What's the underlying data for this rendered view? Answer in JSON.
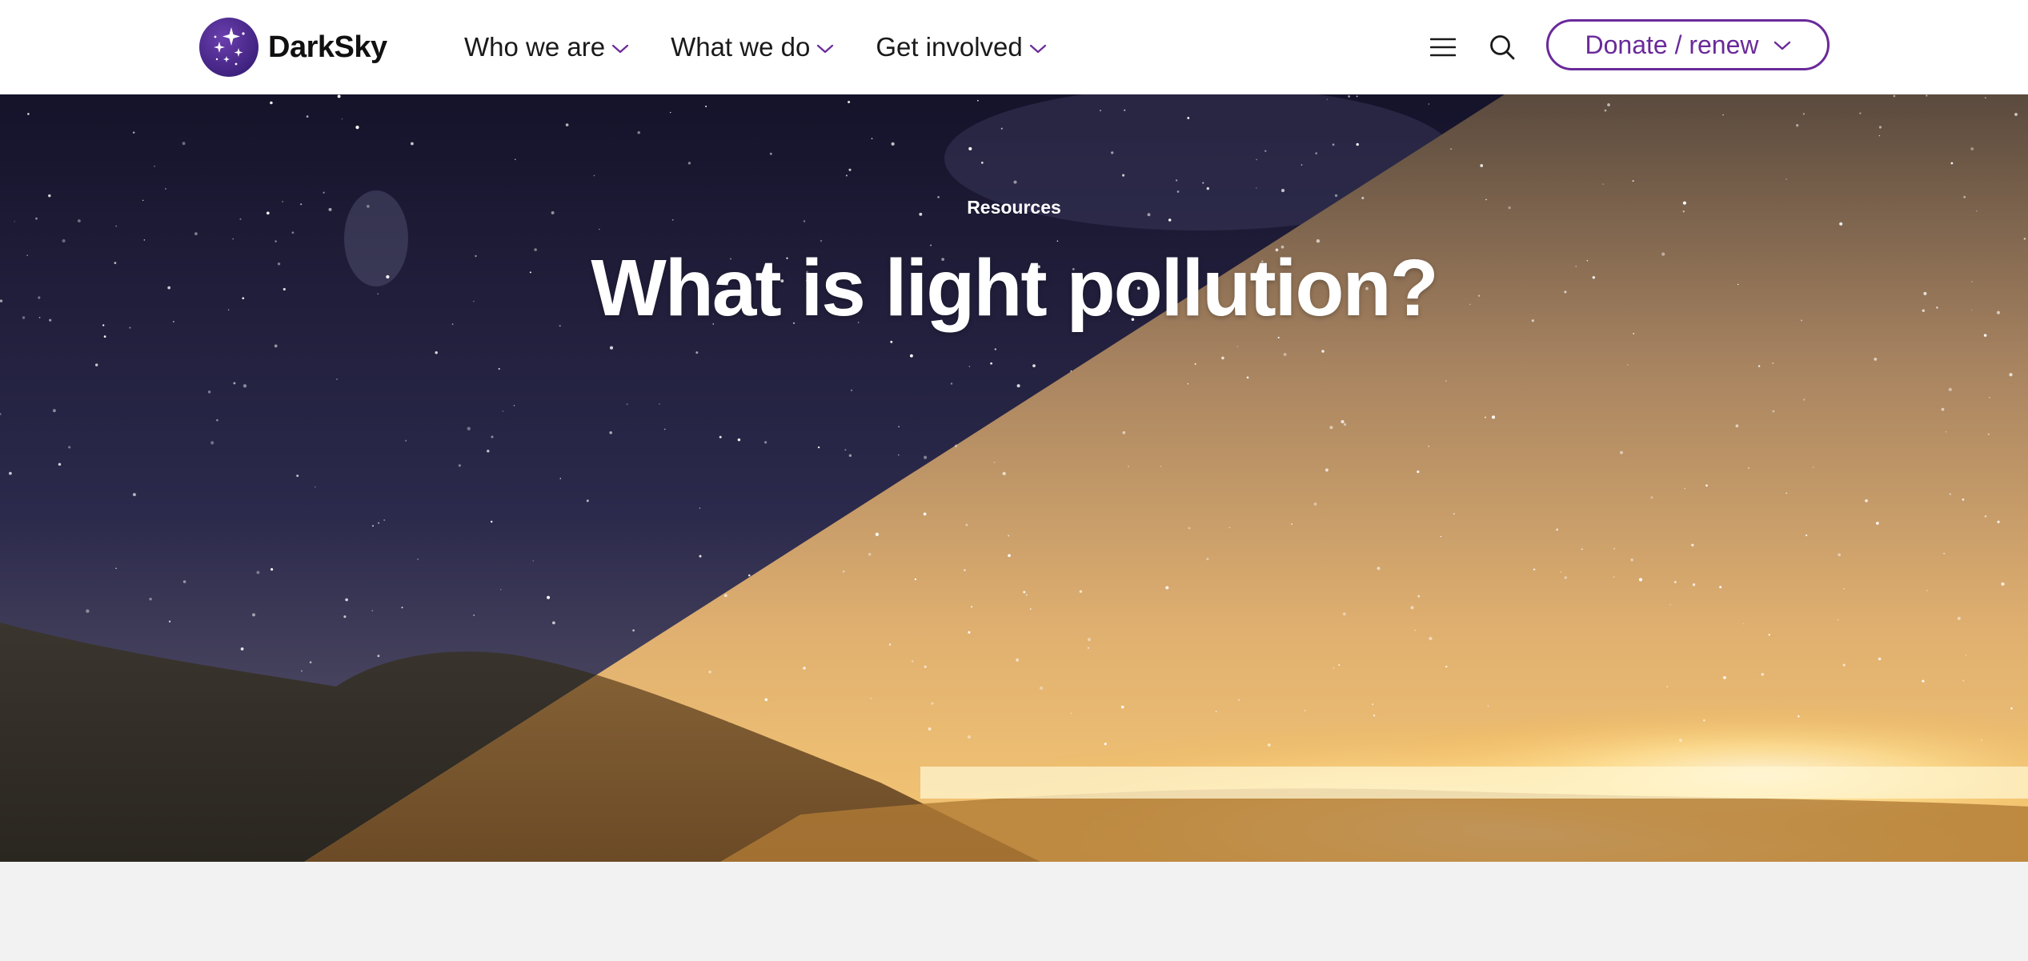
{
  "header": {
    "logo_text": "DarkSky",
    "nav": [
      {
        "label": "Who we are"
      },
      {
        "label": "What we do"
      },
      {
        "label": "Get involved"
      }
    ],
    "menu_icon": "hamburger-menu-icon",
    "search_icon": "search-icon",
    "donate_label": "Donate / renew"
  },
  "hero": {
    "eyebrow": "Resources",
    "title": "What is light pollution?"
  },
  "colors": {
    "brand_purple": "#6a2a9a",
    "logo_purple": "#4a2a8a",
    "header_bg": "#ffffff",
    "page_bg": "#f2f2f2"
  }
}
